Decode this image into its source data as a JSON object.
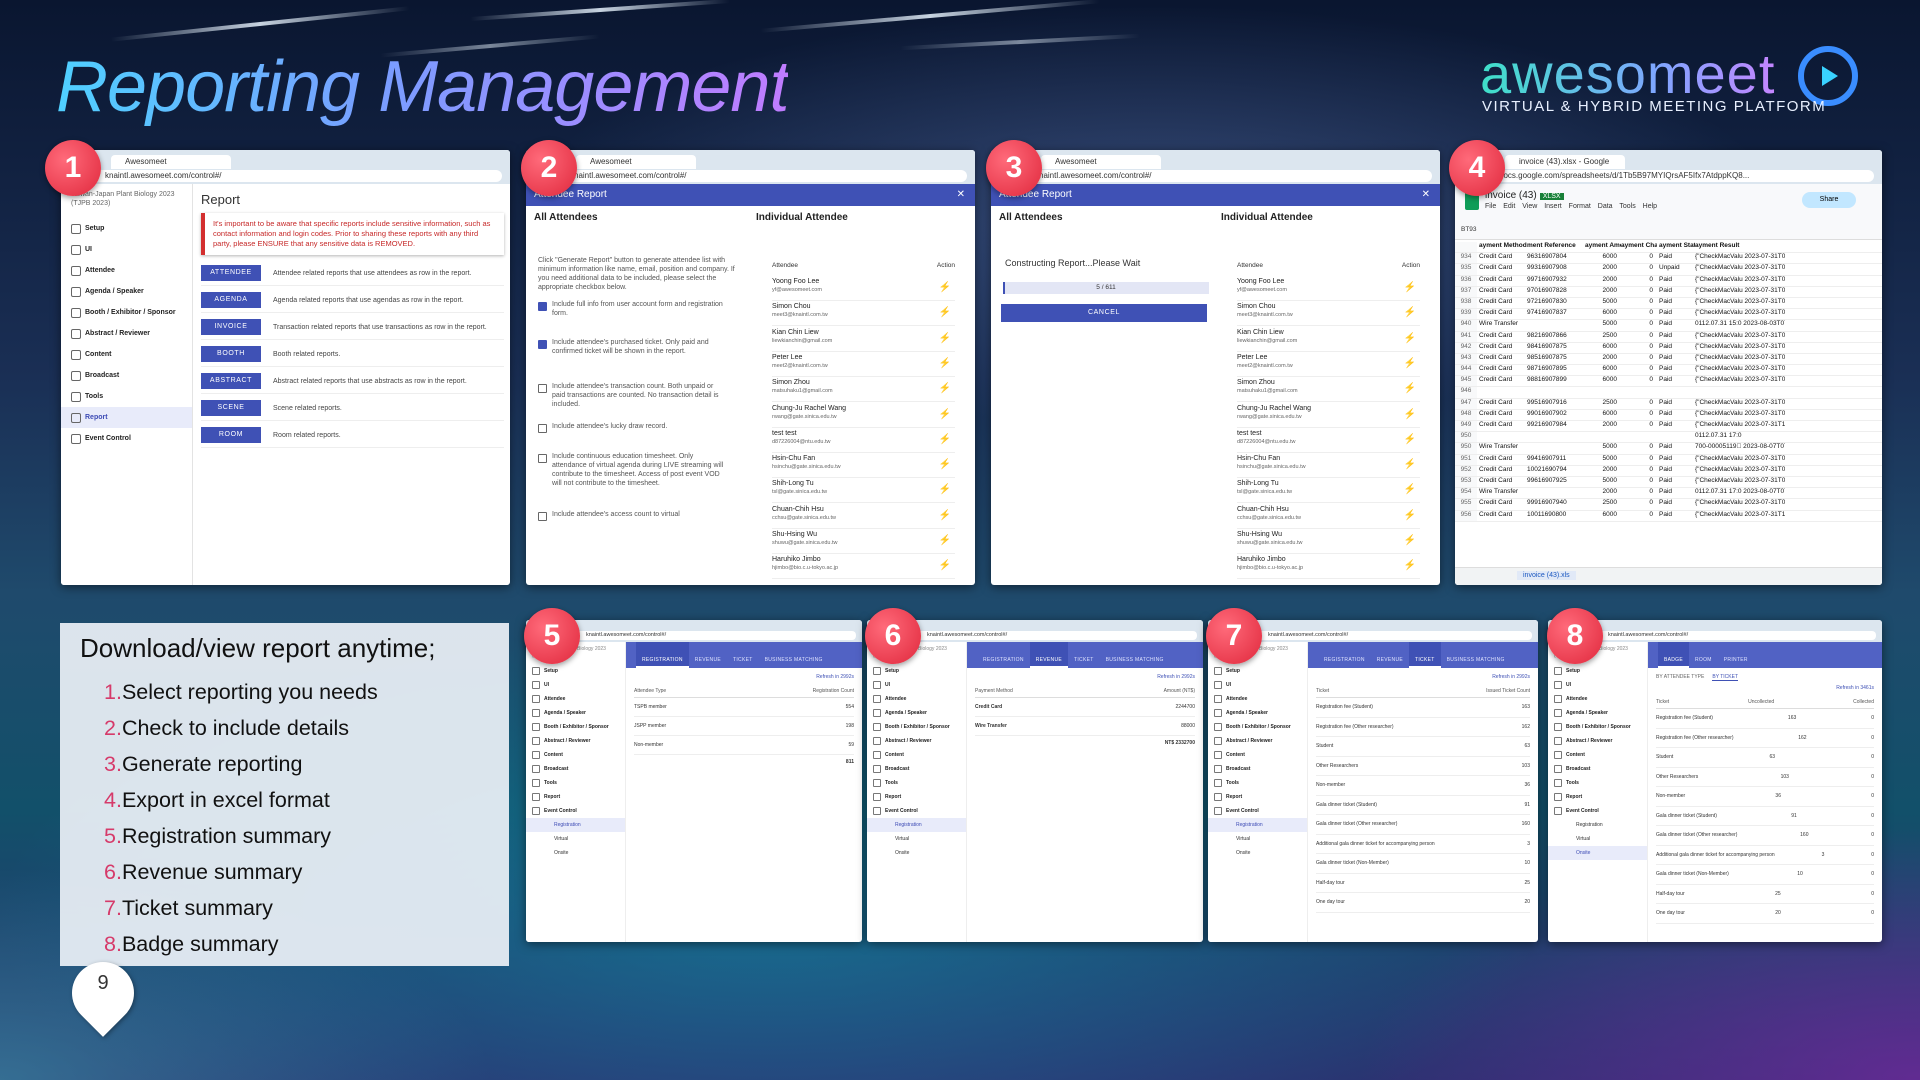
{
  "slide": {
    "title": "Reporting Management",
    "page_number": "9",
    "brand": {
      "name": "awesomeet",
      "tagline": "VIRTUAL & HYBRID MEETING PLATFORM"
    },
    "instructions": {
      "heading": "Download/view report anytime;",
      "steps": [
        {
          "n": "1.",
          "text": "Select reporting you needs"
        },
        {
          "n": "2.",
          "text": "Check to include details"
        },
        {
          "n": "3.",
          "text": "Generate reporting"
        },
        {
          "n": "4.",
          "text": "Export in excel format"
        },
        {
          "n": "5.",
          "text": "Registration summary"
        },
        {
          "n": "6.",
          "text": "Revenue summary"
        },
        {
          "n": "7.",
          "text": "Ticket summary"
        },
        {
          "n": "8.",
          "text": "Badge summary"
        }
      ]
    },
    "badges": [
      "1",
      "2",
      "3",
      "4",
      "5",
      "6",
      "7",
      "8"
    ]
  },
  "browser": {
    "tab_title": "Awesomeet",
    "url": "knaintl.awesomeet.com/control#/",
    "sheet_tab": "invoice (43).xlsx - Google She",
    "sheet_url": "docs.google.com/spreadsheets/d/1Tb5B97MYIQrsAF5Ifx7AtdppKQ8..."
  },
  "sidebar": {
    "org": "Taiwan-Japan Plant Biology 2023 (TJPB 2023)",
    "items": [
      "Setup",
      "UI",
      "Attendee",
      "Agenda / Speaker",
      "Booth / Exhibitor / Sponsor",
      "Abstract / Reviewer",
      "Content",
      "Broadcast",
      "Tools",
      "Report",
      "Event Control"
    ],
    "sub_items": [
      "Registration",
      "Virtual",
      "Onsite"
    ]
  },
  "report_page": {
    "heading": "Report",
    "warning": "It's important to be aware that specific reports include sensitive information, such as contact information and login codes. Prior to sharing these reports with any third party, please ENSURE that any sensitive data is REMOVED.",
    "rows": [
      {
        "button": "ATTENDEE",
        "desc": "Attendee related reports that use attendees as row in the report."
      },
      {
        "button": "AGENDA",
        "desc": "Agenda related reports that use agendas as row in the report."
      },
      {
        "button": "INVOICE",
        "desc": "Transaction related reports that use transactions as row in the report."
      },
      {
        "button": "BOOTH",
        "desc": "Booth related reports."
      },
      {
        "button": "ABSTRACT",
        "desc": "Abstract related reports that use abstracts as row in the report."
      },
      {
        "button": "SCENE",
        "desc": "Scene related reports."
      },
      {
        "button": "ROOM",
        "desc": "Room related reports."
      }
    ]
  },
  "attendee_modal": {
    "title": "Attendee Report",
    "close": "✕",
    "all_attendees": "All Attendees",
    "individual": "Individual Attendee",
    "intro": "Click \"Generate Report\" button to generate attendee list with minimum information like name, email, position and company. If you need additional data to be included, please select the appropriate checkbox below.",
    "options": [
      {
        "text": "Include full info from user account form and registration form.",
        "checked": true
      },
      {
        "text": "Include attendee's purchased ticket. Only paid and confirmed ticket will be shown in the report.",
        "checked": true
      },
      {
        "text": "Include attendee's transaction count. Both unpaid or paid transactions are counted. No transaction detail is included.",
        "checked": false
      },
      {
        "text": "Include attendee's lucky draw record.",
        "checked": false
      },
      {
        "text": "Include continuous education timesheet. Only attendance of virtual agenda during LIVE streaming will contribute to the timesheet. Access of post event VOD will not contribute to the timesheet.",
        "checked": false
      },
      {
        "text": "Include attendee's access count to virtual",
        "checked": false
      }
    ],
    "col_attendee": "Attendee",
    "col_action": "Action",
    "constructing": "Constructing Report...Please Wait",
    "progress": "5 / 611",
    "progress_fraction": 0.008,
    "cancel": "CANCEL",
    "attendees": [
      {
        "name": "Yoong Foo Lee",
        "email": "yf@awesomeet.com"
      },
      {
        "name": "Simon Chou",
        "email": "meet3@knaintl.com.tw"
      },
      {
        "name": "Kian Chin Liew",
        "email": "liewkianchin@gmail.com"
      },
      {
        "name": "Peter Lee",
        "email": "meet2@knaintl.com.tw"
      },
      {
        "name": "Simon Zhou",
        "email": "matsuhaku1@gmail.com"
      },
      {
        "name": "Chung-Ju Rachel Wang",
        "email": "rwang@gate.sinica.edu.tw"
      },
      {
        "name": "test test",
        "email": "d87226004@ntu.edu.tw"
      },
      {
        "name": "Hsin-Chu Fan",
        "email": "hsinchu@gate.sinica.edu.tw"
      },
      {
        "name": "Shih-Long Tu",
        "email": "tsl@gate.sinica.edu.tw"
      },
      {
        "name": "Chuan-Chih Hsu",
        "email": "cchsu@gate.sinica.edu.tw"
      },
      {
        "name": "Shu-Hsing Wu",
        "email": "shuwu@gate.sinica.edu.tw"
      },
      {
        "name": "Haruhiko Jimbo",
        "email": "hjimbo@bio.c.u-tokyo.ac.jp"
      }
    ]
  },
  "spreadsheet": {
    "file": "invoice (43)",
    "ext": "XLSX",
    "menu": "File Edit View Insert Format Data Tools Help",
    "share": "Share",
    "cell_ref": "BT93",
    "header": [
      "",
      "ayment Method",
      "ment Reference",
      "ayment Amount",
      "ayment Charges",
      "ayment Status",
      "ayment Result"
    ],
    "rows": [
      [
        "934",
        "Credit Card",
        "96316907804",
        "6000",
        "0",
        "Paid",
        "{\"CheckMacValu 2023-07-31T05:16:36.000"
      ],
      [
        "935",
        "Credit Card",
        "99316907908",
        "2000",
        "0",
        "Unpaid",
        "{\"CheckMacValu 2023-07-31T08:18:13.000"
      ],
      [
        "936",
        "Credit Card",
        "99716907932",
        "2000",
        "0",
        "Paid",
        "{\"CheckMacValu 2023-07-31T08:49:12.000"
      ],
      [
        "937",
        "Credit Card",
        "97016907828",
        "2000",
        "0",
        "Paid",
        "{\"CheckMacValu 2023-07-31T05:56:09.000"
      ],
      [
        "938",
        "Credit Card",
        "97216907830",
        "5000",
        "0",
        "Paid",
        "{\"CheckMacValu 2023-07-31T06:00:24.000"
      ],
      [
        "939",
        "Credit Card",
        "97416907837",
        "6000",
        "0",
        "Paid",
        "{\"CheckMacValu 2023-07-31T06:15:09.000"
      ],
      [
        "940",
        "Wire Transfer",
        "",
        "5000",
        "0",
        "Paid",
        "0112.07.31 15:0 2023-08-03T07:28:10.000"
      ],
      [
        "941",
        "Credit Card",
        "98216907866",
        "2500",
        "0",
        "Paid",
        "{\"CheckMacValu 2023-07-31T06:58:48.000"
      ],
      [
        "942",
        "Credit Card",
        "98416907875",
        "6000",
        "0",
        "Paid",
        "{\"CheckMacValu 2023-07-31T07:16:20.000"
      ],
      [
        "943",
        "Credit Card",
        "98516907875",
        "2000",
        "0",
        "Paid",
        "{\"CheckMacValu 2023-07-31T07:16:30.000"
      ],
      [
        "944",
        "Credit Card",
        "98716907895",
        "6000",
        "0",
        "Paid",
        "{\"CheckMacValu 2023-07-31T07:47:34.000"
      ],
      [
        "945",
        "Credit Card",
        "98816907899",
        "6000",
        "0",
        "Paid",
        "{\"CheckMacValu 2023-07-31T07:55:39.000"
      ],
      [
        "946",
        "",
        "",
        "",
        "",
        "",
        ""
      ],
      [
        "947",
        "Credit Card",
        "99516907916",
        "2500",
        "0",
        "Paid",
        "{\"CheckMacValu 2023-07-31T08:22:22.000"
      ],
      [
        "948",
        "Credit Card",
        "99016907902",
        "6000",
        "0",
        "Paid",
        "{\"CheckMacValu 2023-07-31T07:59:36.000"
      ],
      [
        "949",
        "Credit Card",
        "99216907984",
        "2000",
        "0",
        "Paid",
        "{\"CheckMacValu 2023-07-31T10:17:38.000"
      ],
      [
        "950",
        "",
        "",
        "",
        "",
        "",
        "0112.07.31 17:0"
      ],
      [
        "950",
        "Wire Transfer",
        "",
        "5000",
        "0",
        "Paid",
        "700-00005119\u0000 2023-08-07T07:49:43.000"
      ],
      [
        "951",
        "Credit Card",
        "99416907911",
        "5000",
        "0",
        "Paid",
        "{\"CheckMacValu 2023-07-31T08:16:03.000"
      ],
      [
        "952",
        "Credit Card",
        "10021690794",
        "2000",
        "0",
        "Paid",
        "{\"CheckMacValu 2023-07-31T09:10:18.000"
      ],
      [
        "953",
        "Credit Card",
        "99616907925",
        "5000",
        "0",
        "Paid",
        "{\"CheckMacValu 2023-07-31T08:38:51.000"
      ],
      [
        "954",
        "Wire Transfer",
        "",
        "2000",
        "0",
        "Paid",
        "0112.07.31 17:0 2023-08-07T07:39:05.000"
      ],
      [
        "955",
        "Credit Card",
        "99916907940",
        "2500",
        "0",
        "Paid",
        "{\"CheckMacValu 2023-07-31T09:02:13.000"
      ],
      [
        "956",
        "Credit Card",
        "10011690800",
        "6000",
        "0",
        "Paid",
        "{\"CheckMacValu 2023-07-31T15:51:17.000"
      ]
    ],
    "sheet_tab": "invoice (43).xls"
  },
  "summaries": {
    "registration": {
      "tabs": [
        "REGISTRATION",
        "REVENUE",
        "TICKET",
        "BUSINESS MATCHING"
      ],
      "active": 0,
      "refresh": "Refresh in 2992s",
      "head": [
        "Attendee Type",
        "Registration Count"
      ],
      "rows": [
        [
          "TSPB member",
          "554"
        ],
        [
          "JSPP member",
          "198"
        ],
        [
          "Non-member",
          "59"
        ]
      ],
      "total": "811"
    },
    "revenue": {
      "tabs": [
        "REGISTRATION",
        "REVENUE",
        "TICKET",
        "BUSINESS MATCHING"
      ],
      "active": 1,
      "refresh": "Refresh in 2992s",
      "head": [
        "Payment Method",
        "Amount (NT$)"
      ],
      "rows": [
        [
          "Credit Card",
          "2244700"
        ],
        [
          "Wire Transfer",
          "88000"
        ]
      ],
      "total": "NT$ 2332700"
    },
    "ticket": {
      "tabs": [
        "REGISTRATION",
        "REVENUE",
        "TICKET",
        "BUSINESS MATCHING"
      ],
      "active": 2,
      "refresh": "Refresh in 2992s",
      "head": [
        "Ticket",
        "Issued Ticket Count"
      ],
      "rows": [
        [
          "Registration fee (Student)",
          "163"
        ],
        [
          "Registration fee (Other researcher)",
          "162"
        ],
        [
          "Student",
          "63"
        ],
        [
          "Other Researchers",
          "103"
        ],
        [
          "Non-member",
          "36"
        ],
        [
          "Gala dinner ticket (Student)",
          "91"
        ],
        [
          "Gala dinner ticket (Other researcher)",
          "160"
        ],
        [
          "Additional gala dinner ticket for accompanying person",
          "3"
        ],
        [
          "Gala dinner ticket (Non-Member)",
          "10"
        ],
        [
          "Half-day tour",
          "25"
        ],
        [
          "One day tour",
          "20"
        ]
      ]
    },
    "badge": {
      "tabs": [
        "BADGE",
        "ROOM",
        "PRINTER"
      ],
      "active": 0,
      "filters": [
        "BY ATTENDEE TYPE",
        "BY TICKET"
      ],
      "refresh": "Refresh in 3461s",
      "head": [
        "Ticket",
        "Uncollected",
        "Collected"
      ],
      "rows": [
        [
          "Registration fee (Student)",
          "163",
          "0"
        ],
        [
          "Registration fee (Other researcher)",
          "162",
          "0"
        ],
        [
          "Student",
          "63",
          "0"
        ],
        [
          "Other Researchers",
          "103",
          "0"
        ],
        [
          "Non-member",
          "36",
          "0"
        ],
        [
          "Gala dinner ticket (Student)",
          "91",
          "0"
        ],
        [
          "Gala dinner ticket (Other researcher)",
          "160",
          "0"
        ],
        [
          "Additional gala dinner ticket for accompanying person",
          "3",
          "0"
        ],
        [
          "Gala dinner ticket (Non-Member)",
          "10",
          "0"
        ],
        [
          "Half-day tour",
          "25",
          "0"
        ],
        [
          "One day tour",
          "20",
          "0"
        ]
      ]
    }
  }
}
